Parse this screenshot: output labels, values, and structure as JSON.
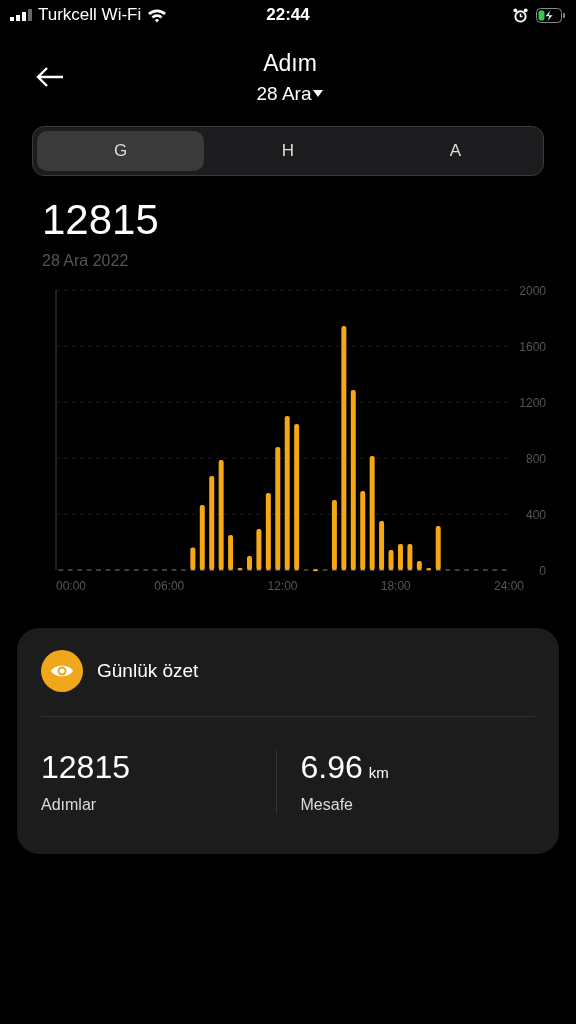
{
  "status_bar": {
    "carrier": "Turkcell Wi-Fi",
    "time": "22:44",
    "battery_charging": true
  },
  "header": {
    "title": "Adım",
    "date": "28 Ara"
  },
  "tabs": [
    {
      "label": "G",
      "selected": true
    },
    {
      "label": "H",
      "selected": false
    },
    {
      "label": "A",
      "selected": false
    }
  ],
  "total": {
    "value": "12815",
    "date": "28 Ara 2022"
  },
  "chart_data": {
    "type": "bar",
    "grid": true,
    "x": [
      0.25,
      0.75,
      1.25,
      1.75,
      2.25,
      2.75,
      3.25,
      3.75,
      4.25,
      4.75,
      5.25,
      5.75,
      6.25,
      6.75,
      7.25,
      7.75,
      8.25,
      8.75,
      9.25,
      9.75,
      10.25,
      10.75,
      11.25,
      11.75,
      12.25,
      12.75,
      13.25,
      13.75,
      14.25,
      14.75,
      15.25,
      15.75,
      16.25,
      16.75,
      17.25,
      17.75,
      18.25,
      18.75,
      19.25,
      19.75,
      20.25,
      20.75,
      21.25,
      21.75,
      22.25,
      22.75,
      23.25,
      23.75
    ],
    "series": [
      {
        "color": "#f5a716",
        "values": [
          0,
          0,
          0,
          0,
          0,
          0,
          0,
          0,
          0,
          0,
          0,
          0,
          0,
          0,
          160,
          464,
          671,
          786,
          250,
          14,
          100,
          293,
          550,
          879,
          1100,
          1043,
          0,
          5,
          0,
          500,
          1743,
          1286,
          564,
          814,
          350,
          143,
          186,
          186,
          64,
          14,
          314,
          0,
          0,
          0,
          0,
          0,
          0,
          0
        ]
      }
    ],
    "xlim": [
      0,
      24
    ],
    "ylim": [
      0,
      2000
    ],
    "xticks": [
      {
        "value": 0,
        "label": "00:00"
      },
      {
        "value": 6,
        "label": "06:00"
      },
      {
        "value": 12,
        "label": "12:00"
      },
      {
        "value": 18,
        "label": "18:00"
      },
      {
        "value": 24,
        "label": "24:00"
      }
    ],
    "yticks": [
      0,
      400,
      800,
      1200,
      1600,
      2000
    ]
  },
  "summary": {
    "title": "Günlük özet",
    "stats": [
      {
        "value": "12815",
        "label": "Adımlar"
      },
      {
        "value": "6.96",
        "unit": "km",
        "label": "Mesafe"
      }
    ]
  }
}
